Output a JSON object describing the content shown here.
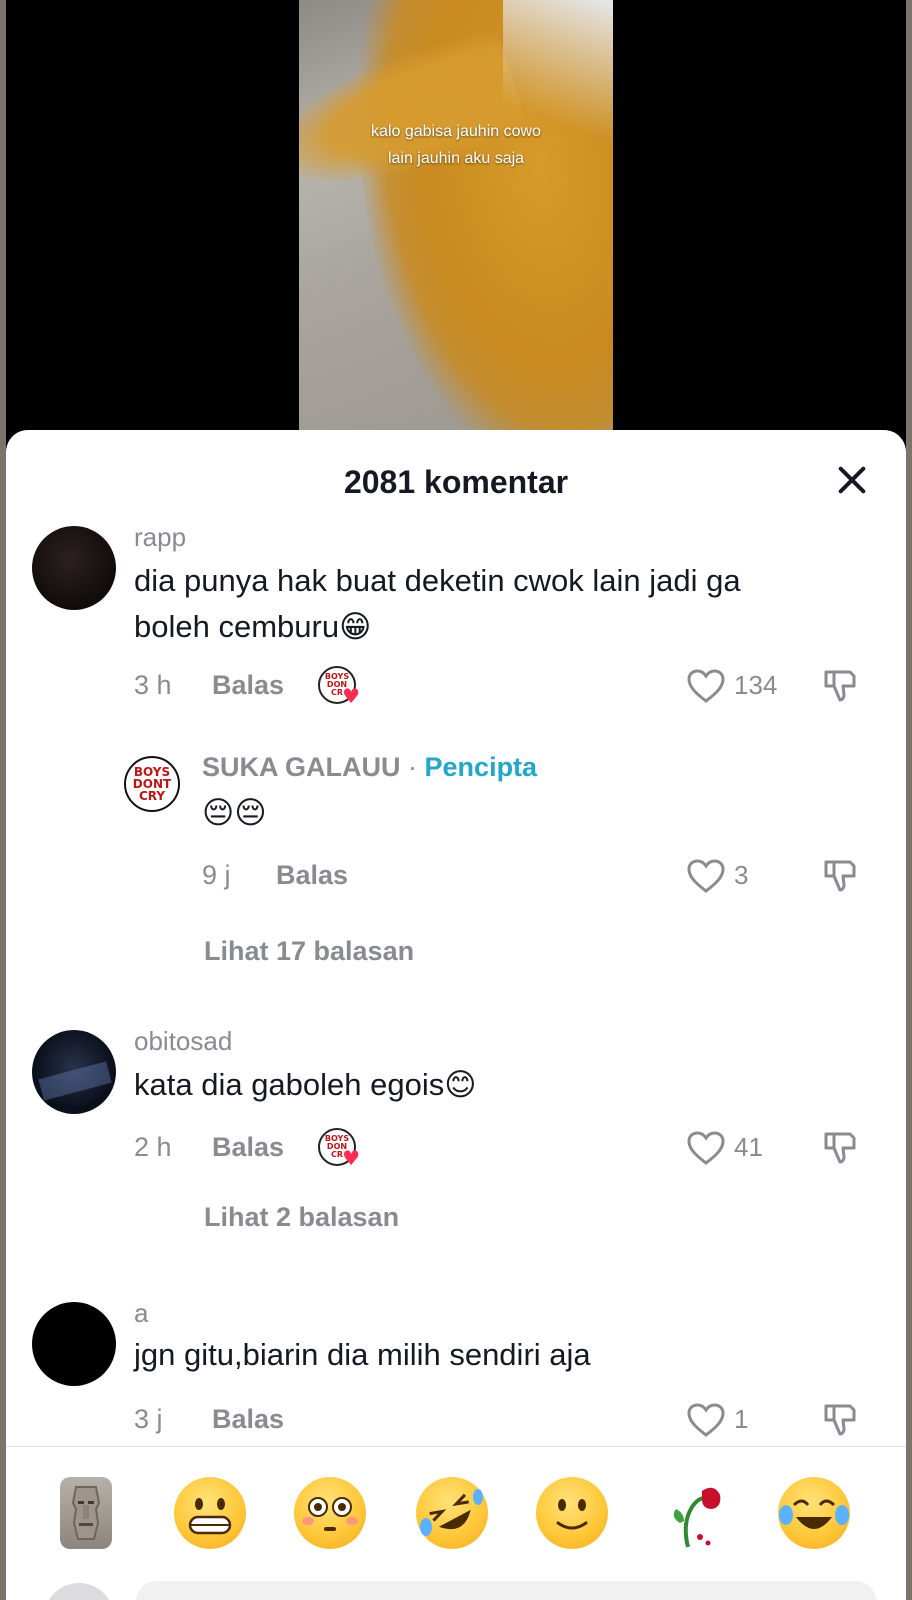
{
  "video": {
    "caption_line1": "kalo gabisa jauhin cowo",
    "caption_line2": "lain jauhin aku saja"
  },
  "sheet": {
    "title": "2081 komentar",
    "close_icon": "close-icon"
  },
  "comments": [
    {
      "username": "rapp",
      "text_line1": "dia punya hak buat deketin cwok lain jadi ga",
      "text_line2": "boleh cemburu😁",
      "time": "3 h",
      "reply_label": "Balas",
      "likes": "134",
      "creator_liked": true
    },
    {
      "username": "obitosad",
      "text_line1": "kata dia gaboleh egois😊",
      "time": "2 h",
      "reply_label": "Balas",
      "likes": "41",
      "creator_liked": true,
      "view_replies": "Lihat 2 balasan"
    },
    {
      "username": "a",
      "text_line1": "jgn gitu,biarin dia milih sendiri aja",
      "time": "3 j",
      "reply_label": "Balas",
      "likes": "1"
    }
  ],
  "creator_reply": {
    "username": "SUKA GALAUU",
    "separator": "·",
    "role": "Pencipta",
    "text": "😔😔",
    "time": "9 j",
    "reply_label": "Balas",
    "likes": "3",
    "view_replies": "Lihat 17 balasan",
    "avatar_text": [
      "BOYS",
      "DONT",
      "CRY"
    ]
  },
  "badge_text": [
    "BOYS",
    "DON",
    "CR"
  ],
  "emoji_bar": [
    "moai-emoji",
    "grin-emoji",
    "flushed-emoji",
    "rofl-emoji",
    "slight-smile-emoji",
    "wilted-rose-emoji",
    "joy-emoji"
  ],
  "colors": {
    "accent_creator": "#20a7c9",
    "muted_text": "#8a8b91",
    "primary_text": "#161823"
  }
}
